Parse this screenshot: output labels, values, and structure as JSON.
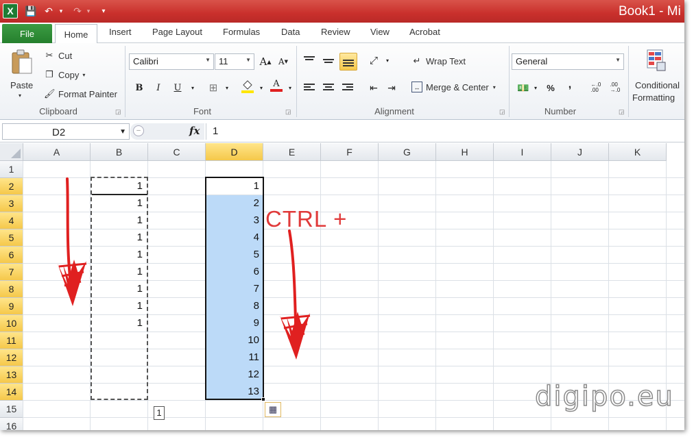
{
  "window": {
    "title": "Book1  -  Mi"
  },
  "quick_access": {
    "excel_logo": "X",
    "save": "💾",
    "undo": "↶",
    "undo_dd": "▾",
    "redo": "↷",
    "redo_dd": "▾",
    "customize": "▾"
  },
  "tabs": [
    {
      "label": "File"
    },
    {
      "label": "Home"
    },
    {
      "label": "Insert"
    },
    {
      "label": "Page Layout"
    },
    {
      "label": "Formulas"
    },
    {
      "label": "Data"
    },
    {
      "label": "Review"
    },
    {
      "label": "View"
    },
    {
      "label": "Acrobat"
    }
  ],
  "ribbon": {
    "clipboard": {
      "label": "Clipboard",
      "paste": "Paste",
      "cut": "Cut",
      "copy": "Copy",
      "format_painter": "Format Painter"
    },
    "font": {
      "label": "Font",
      "font_name": "Calibri",
      "font_size": "11",
      "bold": "B",
      "italic": "I",
      "underline": "U",
      "grow": "A",
      "shrink": "A",
      "font_color": "A"
    },
    "alignment": {
      "label": "Alignment",
      "wrap_text": "Wrap Text",
      "merge_center": "Merge & Center"
    },
    "number": {
      "label": "Number",
      "format": "General",
      "percent": "%",
      "comma": ",",
      "inc_decimal": "←.0\n.00",
      "dec_decimal": ".00\n→.0"
    },
    "styles": {
      "conditional_formatting_line1": "Conditional",
      "conditional_formatting_line2": "Formatting"
    }
  },
  "formula_bar": {
    "name_box": "D2",
    "fx": "fx",
    "value": "1"
  },
  "sheet": {
    "columns": [
      "A",
      "B",
      "C",
      "D",
      "E",
      "F",
      "G",
      "H",
      "I",
      "J",
      "K"
    ],
    "rows": [
      "1",
      "2",
      "3",
      "4",
      "5",
      "6",
      "7",
      "8",
      "9",
      "10",
      "11",
      "12",
      "13",
      "14",
      "15",
      "16"
    ],
    "selected_column": "D",
    "column_b_values": [
      "1",
      "1",
      "1",
      "1",
      "1",
      "1",
      "1",
      "1",
      "1"
    ],
    "column_d_values": [
      "1",
      "2",
      "3",
      "4",
      "5",
      "6",
      "7",
      "8",
      "9",
      "10",
      "11",
      "12",
      "13"
    ],
    "fill_tooltip": "1"
  },
  "annotation": {
    "text": "CTRL +",
    "color": "#e03a3a"
  },
  "watermark": "digipo.eu",
  "colors": {
    "title_bar": "#c9302c",
    "file_tab": "#2e8b36",
    "selection": "#bcdaf8",
    "header_selected": "#f5c84a"
  }
}
